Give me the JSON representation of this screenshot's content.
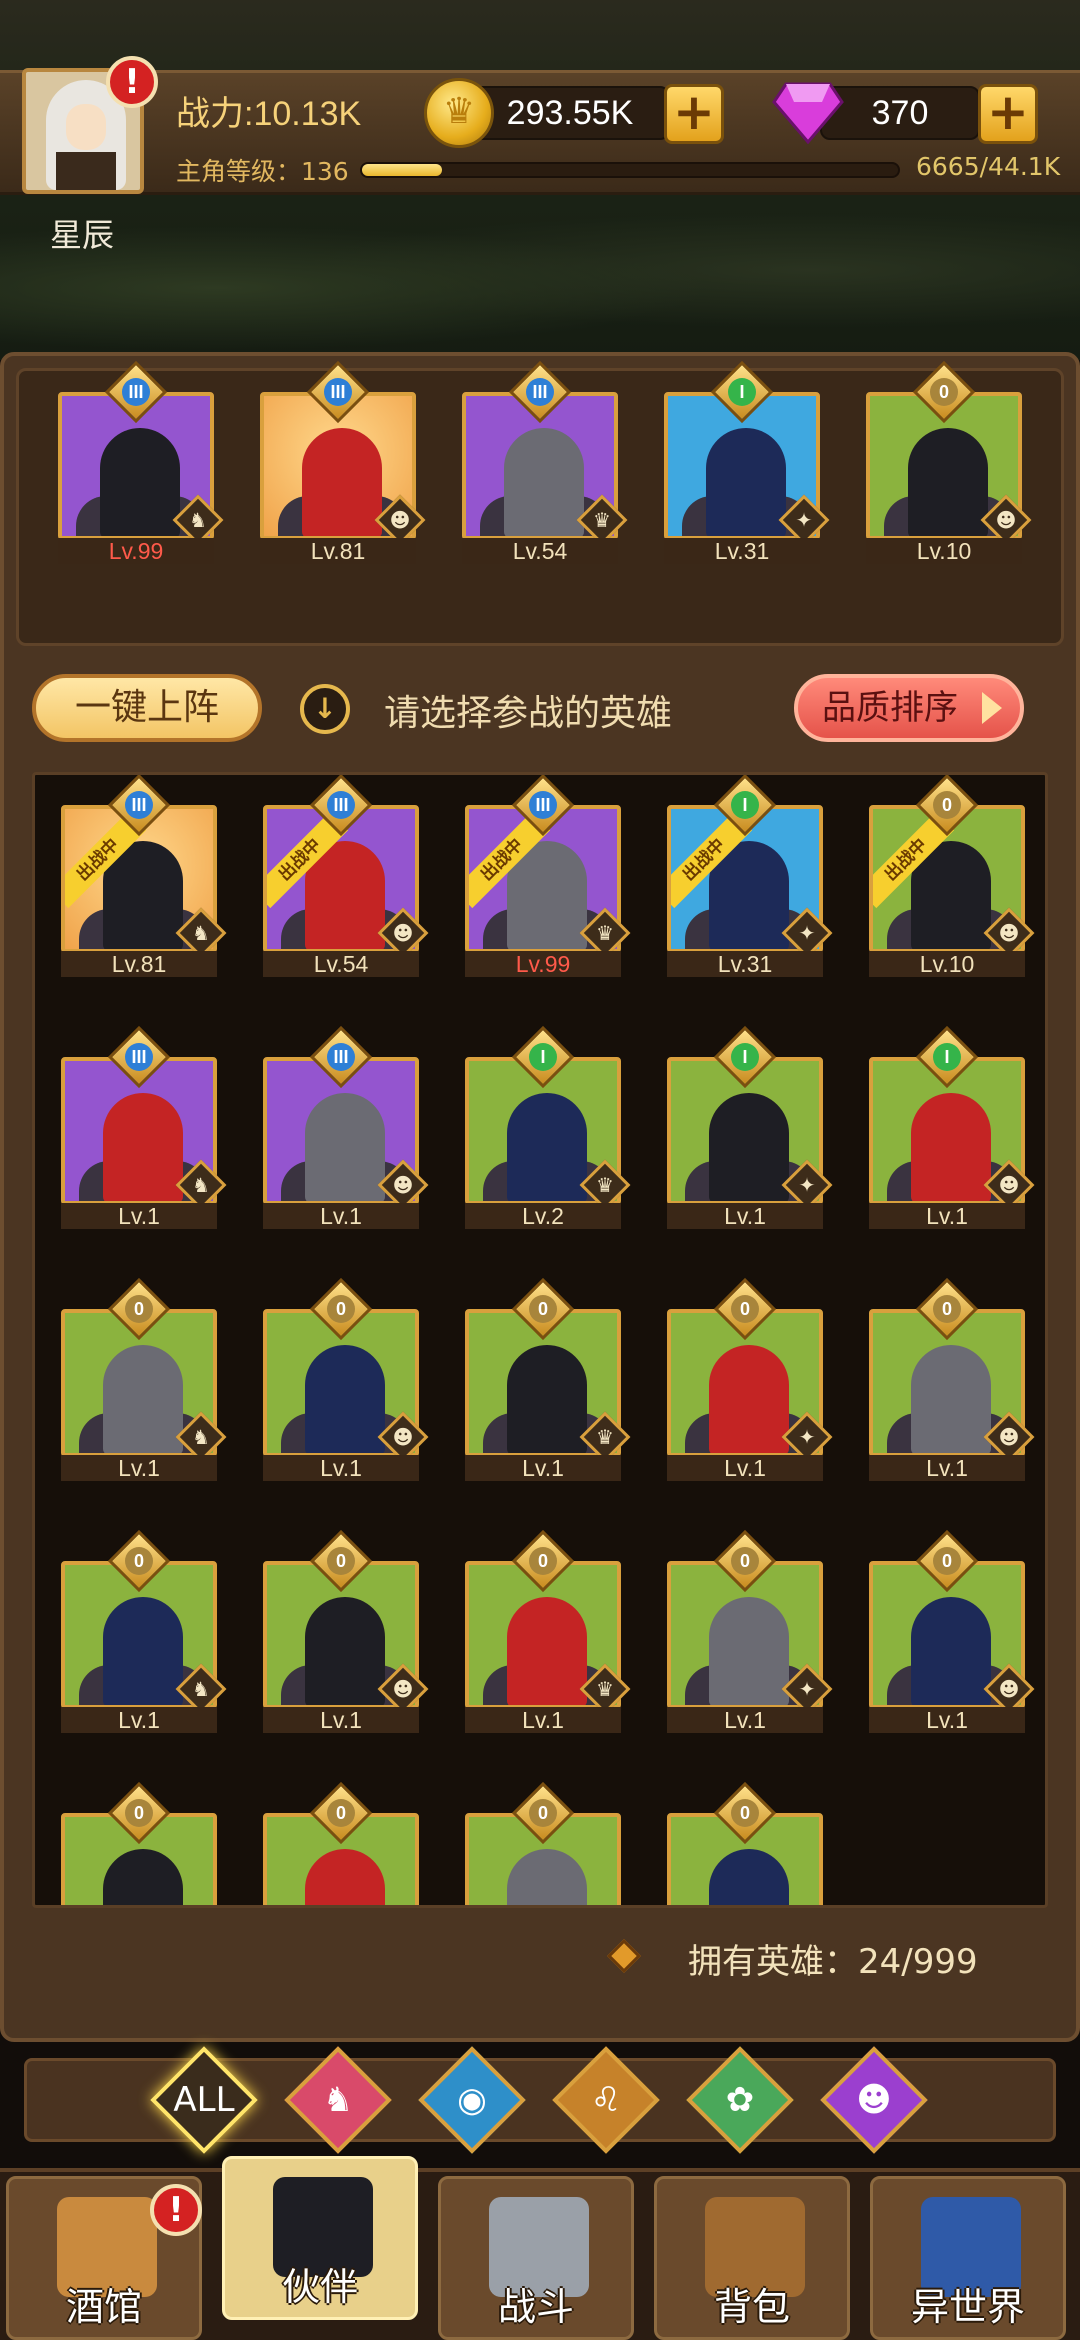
{
  "player": {
    "name": "星辰",
    "power": "战力:10.13K",
    "level_label": "主角等级：136",
    "xp": "6665/44.1K",
    "xp_fraction": 0.15,
    "has_alert": true
  },
  "currency": {
    "gold": "293.55K",
    "gems": "370",
    "coin_glyph": "♛"
  },
  "lineup": [
    {
      "rank": "III",
      "level": "Lv.99",
      "bg": "purple",
      "level_red": true
    },
    {
      "rank": "III",
      "level": "Lv.81",
      "bg": "gold"
    },
    {
      "rank": "III",
      "level": "Lv.54",
      "bg": "purple"
    },
    {
      "rank": "I",
      "level": "Lv.31",
      "bg": "blue"
    },
    {
      "rank": "0",
      "level": "Lv.10",
      "bg": "green"
    }
  ],
  "actions": {
    "one_click": "一键上阵",
    "hint": "请选择参战的英雄",
    "sort": "品质排序"
  },
  "deployed_ribbon": "出战中",
  "heroes": [
    {
      "rank": "III",
      "level": "Lv.81",
      "bg": "gold",
      "deployed": true
    },
    {
      "rank": "III",
      "level": "Lv.54",
      "bg": "purple",
      "deployed": true
    },
    {
      "rank": "III",
      "level": "Lv.99",
      "bg": "purple",
      "deployed": true,
      "level_red": true
    },
    {
      "rank": "I",
      "level": "Lv.31",
      "bg": "blue",
      "deployed": true
    },
    {
      "rank": "0",
      "level": "Lv.10",
      "bg": "green",
      "deployed": true
    },
    {
      "rank": "III",
      "level": "Lv.1",
      "bg": "purple"
    },
    {
      "rank": "III",
      "level": "Lv.1",
      "bg": "purple"
    },
    {
      "rank": "I",
      "level": "Lv.2",
      "bg": "green"
    },
    {
      "rank": "I",
      "level": "Lv.1",
      "bg": "green"
    },
    {
      "rank": "I",
      "level": "Lv.1",
      "bg": "green"
    },
    {
      "rank": "0",
      "level": "Lv.1",
      "bg": "green"
    },
    {
      "rank": "0",
      "level": "Lv.1",
      "bg": "green"
    },
    {
      "rank": "0",
      "level": "Lv.1",
      "bg": "green"
    },
    {
      "rank": "0",
      "level": "Lv.1",
      "bg": "green"
    },
    {
      "rank": "0",
      "level": "Lv.1",
      "bg": "green"
    },
    {
      "rank": "0",
      "level": "Lv.1",
      "bg": "green"
    },
    {
      "rank": "0",
      "level": "Lv.1",
      "bg": "green"
    },
    {
      "rank": "0",
      "level": "Lv.1",
      "bg": "green"
    },
    {
      "rank": "0",
      "level": "Lv.1",
      "bg": "green"
    },
    {
      "rank": "0",
      "level": "Lv.1",
      "bg": "green"
    },
    {
      "rank": "0",
      "level": "",
      "bg": "green"
    },
    {
      "rank": "0",
      "level": "",
      "bg": "green"
    },
    {
      "rank": "0",
      "level": "",
      "bg": "green"
    },
    {
      "rank": "0",
      "level": "",
      "bg": "green"
    }
  ],
  "owned": "拥有英雄：24/999",
  "filters": [
    "ALL",
    "knight-faction-icon",
    "fish-faction-icon",
    "lion-faction-icon",
    "elf-faction-icon",
    "demon-faction-icon"
  ],
  "nav": [
    {
      "label": "酒馆",
      "icon": "tavern-icon",
      "alert": true
    },
    {
      "label": "伙伴",
      "icon": "partner-icon",
      "selected": true
    },
    {
      "label": "战斗",
      "icon": "battle-icon"
    },
    {
      "label": "背包",
      "icon": "backpack-icon"
    },
    {
      "label": "异世界",
      "icon": "otherworld-icon"
    }
  ],
  "colors": {
    "purple": "#9455cf",
    "gold": "#f0a34a",
    "blue": "#3fa8e0",
    "green": "#8bb33e",
    "accent": "#d9a03d"
  }
}
